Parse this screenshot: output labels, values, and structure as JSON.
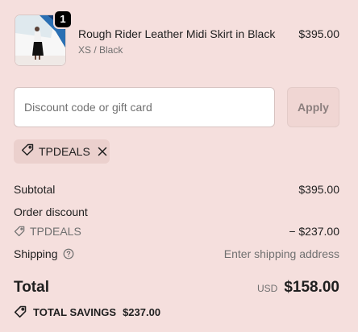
{
  "line_item": {
    "quantity": "1",
    "name": "Rough Rider Leather Midi Skirt in Black",
    "variant": "XS / Black",
    "price": "$395.00"
  },
  "discount": {
    "placeholder": "Discount code or gift card",
    "value": "",
    "apply_label": "Apply",
    "applied_code": "TPDEALS"
  },
  "summary": {
    "subtotal_label": "Subtotal",
    "subtotal_value": "$395.00",
    "order_discount_label": "Order discount",
    "discount_code": "TPDEALS",
    "discount_value": "− $237.00",
    "shipping_label": "Shipping",
    "shipping_value": "Enter shipping address"
  },
  "total": {
    "label": "Total",
    "currency": "USD",
    "amount": "$158.00"
  },
  "savings": {
    "label": "TOTAL SAVINGS",
    "amount": "$237.00"
  },
  "colors": {
    "background": "#f5dfdd",
    "chip_background": "#ebd0cd",
    "apply_button": "#f0d6d3"
  }
}
